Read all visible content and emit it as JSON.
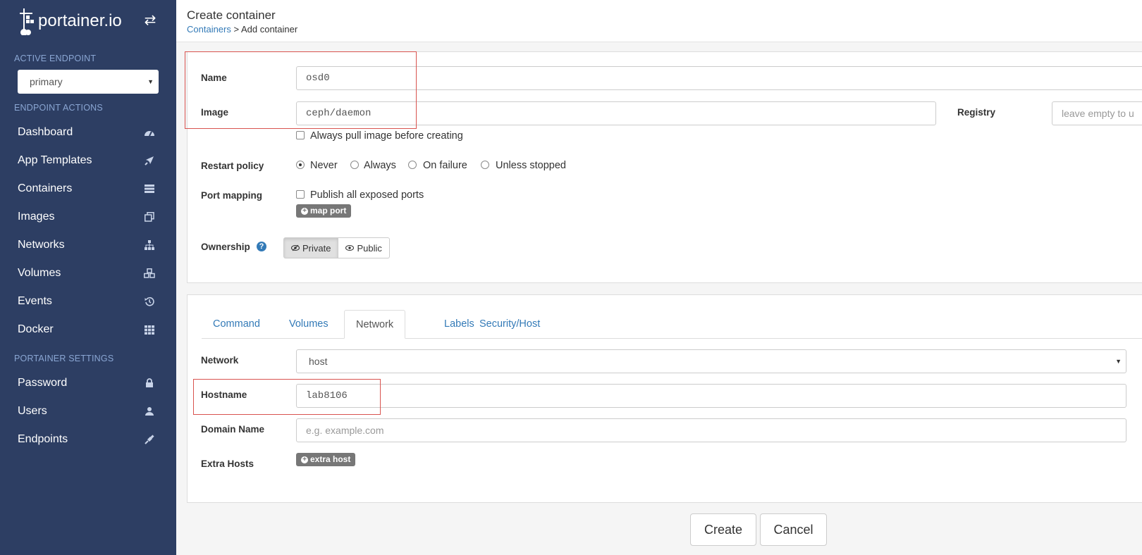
{
  "brand": {
    "name": "portainer.io"
  },
  "sidebar": {
    "active_endpoint_heading": "ACTIVE ENDPOINT",
    "endpoint_value": "primary",
    "endpoint_actions_heading": "ENDPOINT ACTIONS",
    "items": [
      {
        "label": "Dashboard",
        "icon": "dashboard-icon"
      },
      {
        "label": "App Templates",
        "icon": "rocket-icon"
      },
      {
        "label": "Containers",
        "icon": "server-icon"
      },
      {
        "label": "Images",
        "icon": "clone-icon"
      },
      {
        "label": "Networks",
        "icon": "sitemap-icon"
      },
      {
        "label": "Volumes",
        "icon": "cubes-icon"
      },
      {
        "label": "Events",
        "icon": "history-icon"
      },
      {
        "label": "Docker",
        "icon": "th-icon"
      }
    ],
    "settings_heading": "PORTAINER SETTINGS",
    "settings_items": [
      {
        "label": "Password",
        "icon": "lock-icon"
      },
      {
        "label": "Users",
        "icon": "user-icon"
      },
      {
        "label": "Endpoints",
        "icon": "plug-icon"
      }
    ]
  },
  "header": {
    "title": "Create container",
    "breadcrumb_link": "Containers",
    "breadcrumb_sep": " > ",
    "breadcrumb_current": "Add container"
  },
  "form": {
    "name_label": "Name",
    "name_value": "osd0",
    "image_label": "Image",
    "image_value": "ceph/daemon",
    "registry_label": "Registry",
    "registry_placeholder": "leave empty to u",
    "always_pull_label": "Always pull image before creating",
    "restart_label": "Restart policy",
    "restart_options": [
      "Never",
      "Always",
      "On failure",
      "Unless stopped"
    ],
    "restart_selected": "Never",
    "port_label": "Port mapping",
    "publish_label": "Publish all exposed ports",
    "map_port_label": "map port",
    "ownership_label": "Ownership",
    "ownership_private": "Private",
    "ownership_public": "Public"
  },
  "tabs": [
    "Command",
    "Volumes",
    "Network",
    "Labels",
    "Security/Host"
  ],
  "active_tab": "Network",
  "network": {
    "network_label": "Network",
    "network_value": "host",
    "hostname_label": "Hostname",
    "hostname_value": "lab8106",
    "domain_label": "Domain Name",
    "domain_placeholder": "e.g. example.com",
    "extra_hosts_label": "Extra Hosts",
    "extra_host_button": "extra host"
  },
  "actions": {
    "create": "Create",
    "cancel": "Cancel"
  },
  "colors": {
    "sidebar": "#2d3e63",
    "link": "#337ab7",
    "highlight": "#d9534f"
  }
}
